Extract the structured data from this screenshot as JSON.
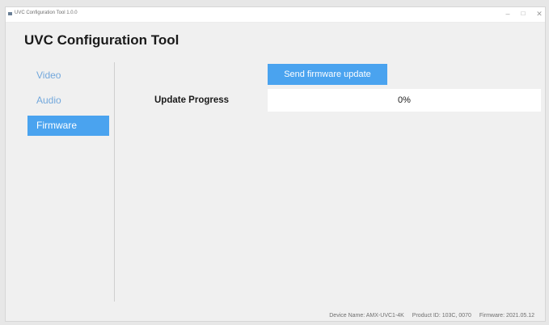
{
  "window": {
    "title": "UVC Configuration Tool 1.0.0",
    "controls": {
      "minimize": "–",
      "maximize": "□",
      "close": "✕"
    }
  },
  "app": {
    "title": "UVC Configuration Tool"
  },
  "sidebar": {
    "items": [
      {
        "label": "Video",
        "active": false
      },
      {
        "label": "Audio",
        "active": false
      },
      {
        "label": "Firmware",
        "active": true
      }
    ]
  },
  "firmware": {
    "send_button_label": "Send firmware update",
    "progress_label": "Update Progress",
    "progress_value": 0,
    "progress_text": "0%"
  },
  "footer": {
    "device_name": "Device Name: AMX-UVC1-4K",
    "product_id": "Product ID: 103C, 0070",
    "firmware": "Firmware: 2021.05.12"
  },
  "colors": {
    "accent": "#4aa3ef",
    "nav_inactive": "#73a8dc",
    "background": "#f0f0f0"
  }
}
